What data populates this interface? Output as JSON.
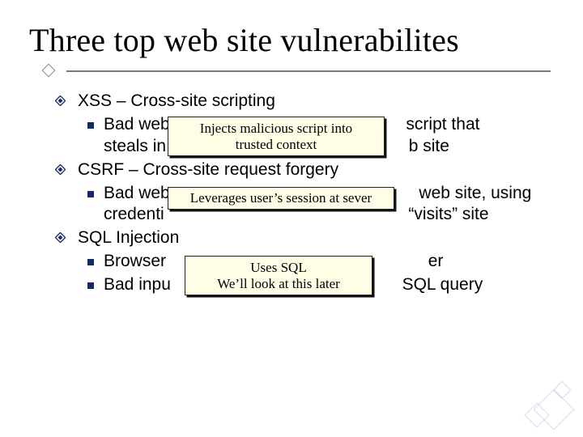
{
  "title": "Three top web site vulnerabilites",
  "sections": [
    {
      "heading": "XSS – Cross-site scripting",
      "items": [
        {
          "line1_pre": "Bad web",
          "line1_post": " script that",
          "line2_pre": "steals in",
          "line2_post": "b site"
        }
      ],
      "popup": [
        "Injects malicious script into",
        "trusted context"
      ]
    },
    {
      "heading": "CSRF – Cross-site request forgery",
      "items": [
        {
          "line1_pre": "Bad web",
          "line1_post": "web site, using",
          "line2_pre": "credenti",
          "line2_post": " “visits” site"
        }
      ],
      "popup": [
        "Leverages user’s session at sever"
      ]
    },
    {
      "heading": "SQL Injection",
      "items": [
        {
          "line1_pre": "Browser",
          "line1_post": "er"
        },
        {
          "line1_pre": "Bad inpu",
          "line1_post": " SQL query"
        }
      ],
      "popup": [
        "Uses SQL",
        "We’ll look at this later"
      ]
    }
  ]
}
